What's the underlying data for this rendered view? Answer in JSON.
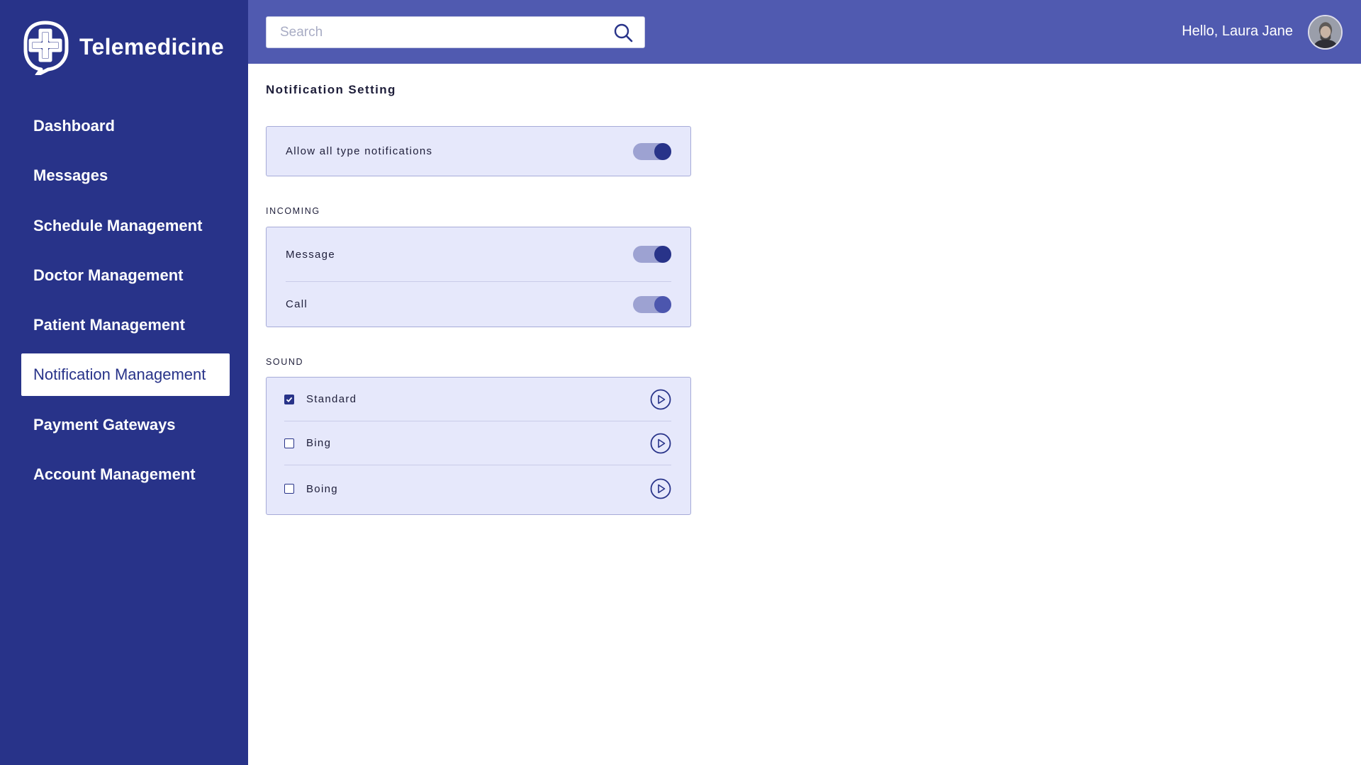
{
  "app": {
    "name": "Telemedicine",
    "logo_icon": "medical-cross-logo"
  },
  "colors": {
    "sidebar": "#283389",
    "header": "#505ab0",
    "card": "#e6e8fb",
    "accent": "#283389"
  },
  "sidebar": {
    "items": [
      {
        "label": "Dashboard"
      },
      {
        "label": "Messages"
      },
      {
        "label": "Schedule Management"
      },
      {
        "label": "Doctor Management"
      },
      {
        "label": "Patient Management"
      },
      {
        "label": "Notification Management",
        "active": true
      },
      {
        "label": "Payment Gateways"
      },
      {
        "label": "Account Management"
      }
    ]
  },
  "header": {
    "search_placeholder": "Search",
    "search_icon": "search-icon",
    "greeting": "Hello, Laura Jane",
    "avatar": "user-avatar"
  },
  "main": {
    "title": "Notification Setting",
    "allow_all": {
      "label": "Allow all type notifications",
      "enabled": true
    },
    "incoming": {
      "label": "INCOMING",
      "items": [
        {
          "label": "Message",
          "enabled": true
        },
        {
          "label": "Call",
          "enabled": true
        }
      ]
    },
    "sound": {
      "label": "SOUND",
      "items": [
        {
          "label": "Standard",
          "checked": true,
          "icon": "play-icon"
        },
        {
          "label": "Bing",
          "checked": false,
          "icon": "play-icon"
        },
        {
          "label": "Boing",
          "checked": false,
          "icon": "play-icon"
        }
      ]
    }
  }
}
